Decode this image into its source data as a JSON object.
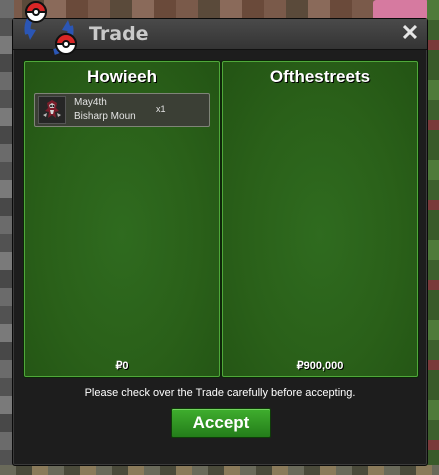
{
  "window": {
    "title": "Trade",
    "close_symbol": "✕",
    "icon": "trade-pokeballs-icon"
  },
  "left_panel": {
    "player_name": "Howieeh",
    "items": [
      {
        "line1": "May4th",
        "line2": "Bisharp Moun",
        "quantity": "x1",
        "icon": "pokemon-icon"
      }
    ],
    "money": "₽0"
  },
  "right_panel": {
    "player_name": "Ofthestreets",
    "items": [],
    "money": "₽900,000"
  },
  "notice": "Please check over the Trade carefully before accepting.",
  "accept_label": "Accept",
  "colors": {
    "panel_green": "#2a6019",
    "accept_green": "#2f9422",
    "window_bg": "#1d1d1d"
  }
}
